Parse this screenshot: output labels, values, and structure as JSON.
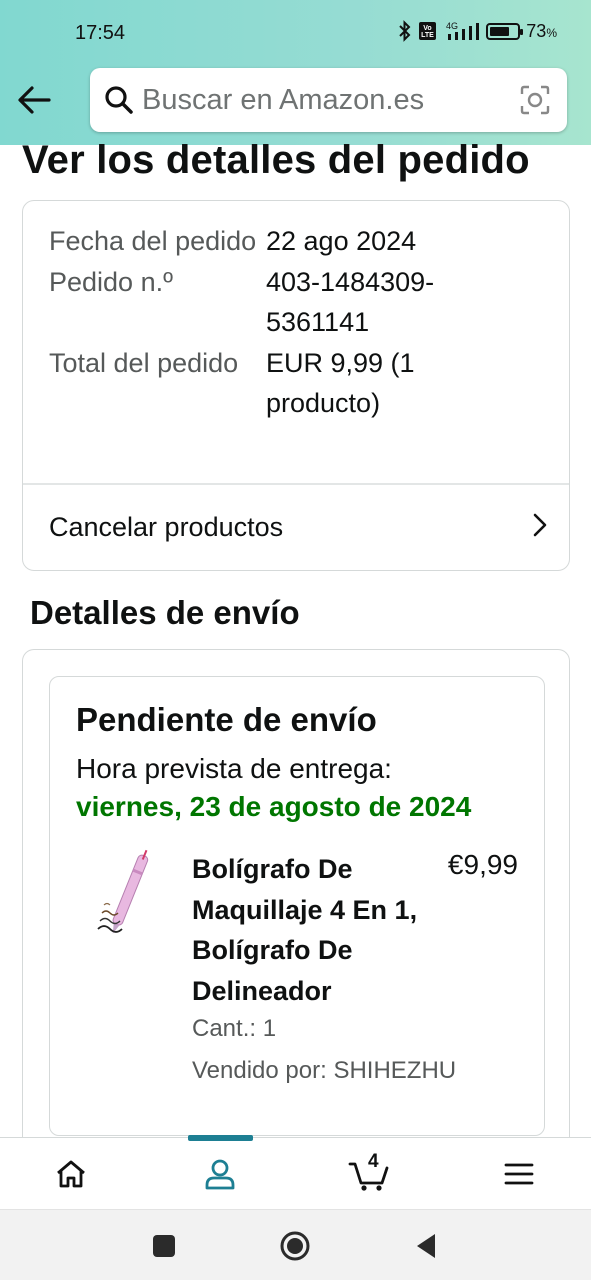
{
  "status_bar": {
    "time": "17:54",
    "network": "4G",
    "battery_pct": "73",
    "battery_unit": "%",
    "battery_level": 0.73
  },
  "search": {
    "placeholder": "Buscar en Amazon.es"
  },
  "page": {
    "title": "Ver los detalles del pedido"
  },
  "order_summary": {
    "rows": [
      {
        "label": "Fecha del pedido",
        "value": "22 ago 2024"
      },
      {
        "label": "Pedido n.º",
        "value": "403-1484309-5361141"
      },
      {
        "label": "Total del pedido",
        "value": "EUR 9,99 (1 producto)"
      }
    ],
    "cancel_label": "Cancelar productos"
  },
  "shipping": {
    "section_title": "Detalles de envío",
    "status": "Pendiente de envío",
    "eta_label": "Hora prevista de entrega:",
    "eta_date": "viernes, 23 de agosto de 2024",
    "item": {
      "name": "Bolígrafo De Maquillaje 4 En 1, Bolígrafo De Delineador",
      "price": "€9,99",
      "quantity": "Cant.: 1",
      "seller": "Vendido por: SHIHEZHU"
    }
  },
  "bottom_nav": {
    "items": [
      "home-icon",
      "account-icon",
      "cart-icon",
      "menu-icon"
    ],
    "active": "account-icon",
    "cart_count": "4",
    "accent_color": "#1d7f93"
  },
  "colors": {
    "header_gradient_start": "#81d8d0",
    "header_gradient_end": "#a7e5cf",
    "eta_green": "#007600",
    "muted_text": "#565959"
  }
}
